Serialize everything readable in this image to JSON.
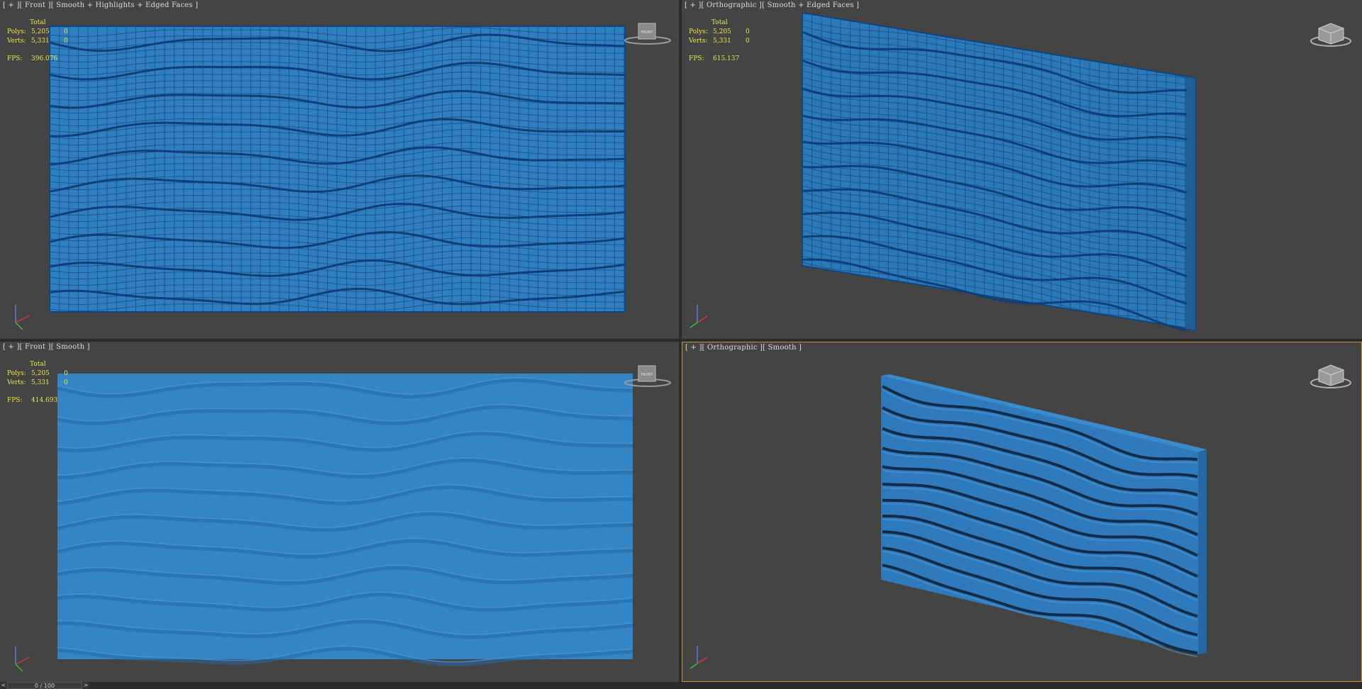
{
  "viewports": {
    "front_shaded": {
      "label": "[ + ][ Front ][ Smooth + Highlights + Edged Faces ]",
      "stats": {
        "total_label": "Total",
        "polys_label": "Polys:",
        "polys_value": "5,205",
        "polys_sel": "0",
        "verts_label": "Verts:",
        "verts_value": "5,331",
        "verts_sel": "0",
        "fps_label": "FPS:",
        "fps_value": "396.076"
      }
    },
    "ortho_shaded": {
      "label": "[ + ][ Orthographic ][ Smooth + Edged Faces ]",
      "stats": {
        "total_label": "Total",
        "polys_label": "Polys:",
        "polys_value": "5,205",
        "polys_sel": "0",
        "verts_label": "Verts:",
        "verts_value": "5,331",
        "verts_sel": "0",
        "fps_label": "FPS:",
        "fps_value": "615.137"
      }
    },
    "front_smooth": {
      "label": "[ + ][ Front ][ Smooth ]",
      "stats": {
        "total_label": "Total",
        "polys_label": "Polys:",
        "polys_value": "5,205",
        "polys_sel": "0",
        "verts_label": "Verts:",
        "verts_value": "5,331",
        "verts_sel": "0",
        "fps_label": "FPS:",
        "fps_value": "414.693"
      }
    },
    "ortho_smooth": {
      "label": "[ + ][ Orthographic ][ Smooth ]"
    }
  },
  "viewcube": {
    "front_label": "FRONT"
  },
  "timeline": {
    "frame_display": "0 / 100",
    "prev_arrow": "<",
    "next_arrow": ">"
  },
  "colors": {
    "panel_blue": "#2f7fc0",
    "wire": "#10447d",
    "viewport_bg": "#444444",
    "stats_text": "#e8e84a",
    "active_border": "#b89a2e"
  },
  "icons": [
    "viewcube-icon",
    "axis-tripod-icon"
  ]
}
